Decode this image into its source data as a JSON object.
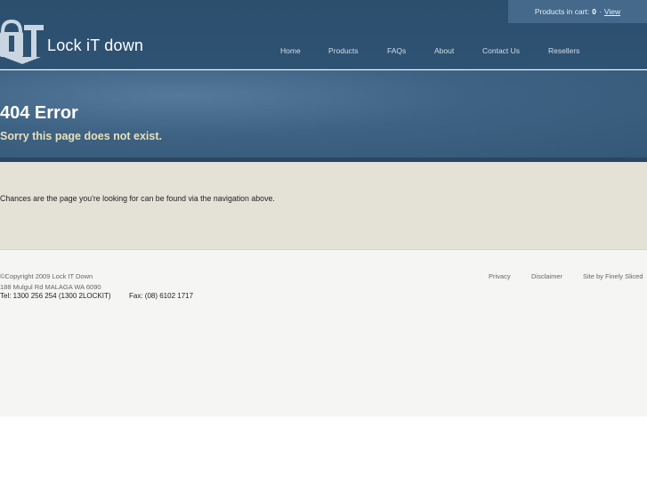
{
  "cart": {
    "label": "Products in cart:",
    "count": "0",
    "separator": "·",
    "view_link": "View"
  },
  "brand": {
    "name": "Lock iT down",
    "colors": {
      "header": "#2c4f6e",
      "banner": "#3e6283",
      "accent_text": "#e8e0b8"
    }
  },
  "nav": {
    "items": [
      "Home",
      "Products",
      "FAQs",
      "About",
      "Contact Us",
      "Resellers"
    ]
  },
  "banner": {
    "title": "404 Error",
    "subtitle": "Sorry this page does not exist."
  },
  "content": {
    "message": "Chances are the page you're looking for can be found via the navigation above."
  },
  "footer": {
    "copyright": "©Copyright 2009 Lock IT Down",
    "address": "188 Mulgul Rd MALAGA WA 6090",
    "tel": "Tel: 1300 256 254 (1300 2LOCKIT)",
    "fax": "Fax: (08) 6102 1717",
    "links": [
      "Privacy",
      "Disclaimer",
      "Site by Finely Sliced"
    ]
  }
}
